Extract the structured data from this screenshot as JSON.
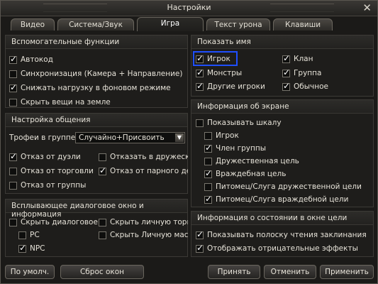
{
  "window": {
    "title": "Настройки"
  },
  "tabs": [
    "Видео",
    "Система/Звук",
    "Игра",
    "Текст урона",
    "Клавиши"
  ],
  "helper_functions": {
    "title": "Вспомогательные функции",
    "items": [
      {
        "label": "Автокод",
        "checked": true
      },
      {
        "label": "Синхронизация (Камера + Направление)",
        "checked": false
      },
      {
        "label": "Снижать нагрузку в фоновом режиме",
        "checked": true
      },
      {
        "label": "Скрыть вещи на земле",
        "checked": false
      }
    ]
  },
  "communication": {
    "title": "Настройка общения",
    "loot_label": "Трофеи в группе",
    "loot_value": "Случайно+Присвоить",
    "items": [
      {
        "label": "Отказ от дуэли",
        "checked": true
      },
      {
        "label": "Отказать в дружеской",
        "checked": false
      },
      {
        "label": "Отказ от торговли",
        "checked": false
      },
      {
        "label": "Отказ от парного дей",
        "checked": true
      },
      {
        "label": "Отказ от группы",
        "checked": false
      }
    ]
  },
  "popup_dialog": {
    "title": "Всплывающее диалоговое окно и информация",
    "items": [
      {
        "label": "Скрыть диалоговое ок",
        "checked": false
      },
      {
        "label": "Скрыть личную торго",
        "checked": false
      },
      {
        "label": "PC",
        "checked": false
      },
      {
        "label": "Скрыть Личную масте",
        "checked": false
      },
      {
        "label": "NPC",
        "checked": true
      }
    ]
  },
  "show_name": {
    "title": "Показать имя",
    "items": [
      {
        "label": "Игрок",
        "checked": true
      },
      {
        "label": "Клан",
        "checked": true
      },
      {
        "label": "Монстры",
        "checked": true
      },
      {
        "label": "Группа",
        "checked": true
      },
      {
        "label": "Другие игроки",
        "checked": true
      },
      {
        "label": "Обычное",
        "checked": true
      }
    ]
  },
  "screen_info": {
    "title": "Информация об экране",
    "items": [
      {
        "label": "Показывать шкалу",
        "checked": false
      },
      {
        "label": "Игрок",
        "checked": false
      },
      {
        "label": "Член группы",
        "checked": true
      },
      {
        "label": "Дружественная цель",
        "checked": false
      },
      {
        "label": "Враждебная цель",
        "checked": true
      },
      {
        "label": "Питомец/Слуга дружественной цели",
        "checked": false
      },
      {
        "label": "Питомец/Слуга враждебной цели",
        "checked": true
      }
    ]
  },
  "target_info": {
    "title": "Информация о состоянии в окне цели",
    "items": [
      {
        "label": "Показывать полоску чтения заклинания",
        "checked": true
      },
      {
        "label": "Отображать отрицательные эффекты",
        "checked": true
      }
    ]
  },
  "buttons": {
    "defaults": "По умолч.",
    "reset_windows": "Сброс окон",
    "accept": "Принять",
    "cancel": "Отменить",
    "apply": "Применить"
  }
}
